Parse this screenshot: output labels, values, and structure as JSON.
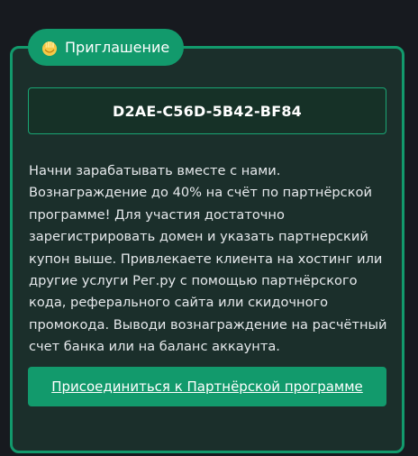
{
  "badge": {
    "icon": "clapping-hands-icon",
    "label": "Приглашение"
  },
  "coupon": {
    "code": "D2AE-C56D-5B42-BF84"
  },
  "description": "Начни зарабатывать вместе с нами. Вознаграждение до 40% на счёт по партнёрской программе! Для участия достаточно зарегистрировать домен и указать партнерский купон выше. Привлекаете клиента на хостинг или другие услуги Рег.ру с помощью партнёрского кода, реферального сайта или скидочного промокода. Выводи вознаграждение на расчётный счет банка или на баланс аккаунта.",
  "join_button": {
    "label": "Присоединиться к Партнёрской программе"
  },
  "colors": {
    "background": "#171a1f",
    "card": "#1b2f2b",
    "accent": "#129a6c",
    "text": "#e6e9ec"
  }
}
